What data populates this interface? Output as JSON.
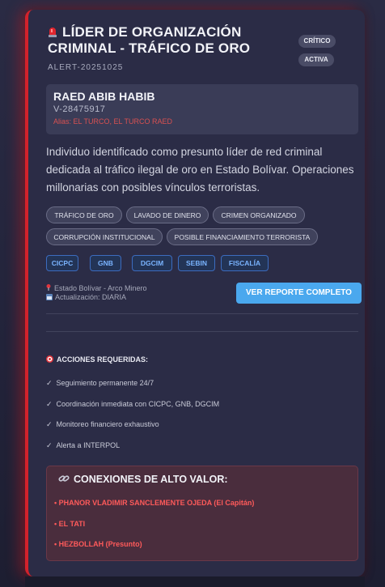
{
  "alert": {
    "title": "LÍDER DE ORGANIZACIÓN CRIMINAL - TRÁFICO DE ORO",
    "id": "ALERT-20251025",
    "badges": {
      "severity": "CRÍTICO",
      "status": "ACTIVA"
    },
    "accent_color": "#d3222b"
  },
  "person": {
    "name": "RAED ABIB HABIB",
    "document": "V-28475917",
    "aliases": "Alias: EL TURCO, EL TURCO RAED"
  },
  "description": "Individuo identificado como presunto líder de red criminal dedicada al tráfico ilegal de oro en Estado Bolívar. Operaciones millonarias con posibles vínculos terroristas.",
  "tags": [
    "TRÁFICO DE ORO",
    "LAVADO DE DINERO",
    "CRIMEN ORGANIZADO",
    "CORRUPCIÓN INSTITUCIONAL",
    "POSIBLE FINANCIAMIENTO TERRORISTA"
  ],
  "agencies": [
    "CICPC",
    "GNB",
    "DGCIM",
    "SEBIN",
    "FISCALÍA"
  ],
  "meta": {
    "location": "Estado Bolívar - Arco Minero",
    "update": "Actualización: DIARIA"
  },
  "report_button": "VER REPORTE COMPLETO",
  "actions": {
    "title": "ACCIONES REQUERIDAS:",
    "check_symbol": "✓",
    "items": [
      "Seguimiento permanente 24/7",
      "Coordinación inmediata con CICPC, GNB, DGCIM",
      "Monitoreo financiero exhaustivo",
      "Alerta a INTERPOL"
    ]
  },
  "connections": {
    "title": "CONEXIONES DE ALTO VALOR:",
    "items": [
      "• PHANOR VLADIMIR SANCLEMENTE OJEDA (El Capitán)",
      "• EL TATI",
      "• HEZBOLLAH (Presunto)"
    ]
  },
  "icons": {
    "title": "siren-icon",
    "location": "pin-icon",
    "update": "calendar-icon",
    "actions": "target-icon",
    "connections": "link-icon"
  }
}
